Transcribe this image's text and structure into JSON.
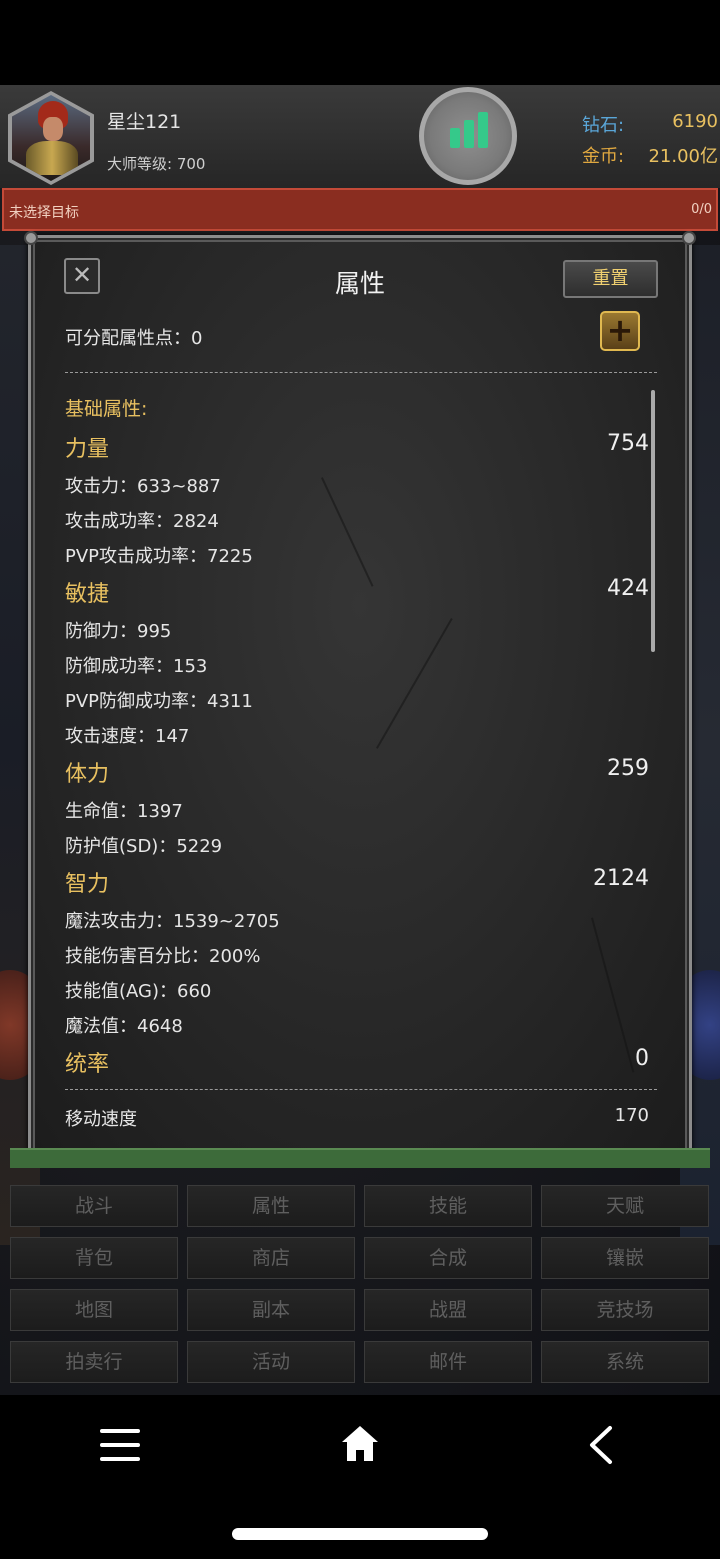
{
  "player": {
    "name": "星尘121",
    "master_level": "大师等级: 700"
  },
  "currency": {
    "diamond_label": "钻石:",
    "diamond_value": "6190",
    "gold_label": "金币:",
    "gold_value": "21.00亿"
  },
  "target": {
    "text": "未选择目标",
    "count": "0/0"
  },
  "panel": {
    "title": "属性",
    "reset_label": "重置",
    "plus_label": "+",
    "points_label": "可分配属性点：0",
    "basic_label": "基础属性:",
    "strength": {
      "label": "力量",
      "value": "754",
      "stats": [
        "攻击力：633~887",
        "攻击成功率：2824",
        "PVP攻击成功率：7225"
      ]
    },
    "agility": {
      "label": "敏捷",
      "value": "424",
      "stats": [
        "防御力：995",
        "防御成功率：153",
        "PVP防御成功率：4311",
        "攻击速度：147"
      ]
    },
    "vitality": {
      "label": "体力",
      "value": "259",
      "stats": [
        "生命值：1397",
        "防护值(SD)：5229"
      ]
    },
    "energy": {
      "label": "智力",
      "value": "2124",
      "stats": [
        "魔法攻击力：1539~2705",
        "技能伤害百分比：200%",
        "技能值(AG)：660",
        "魔法值：4648"
      ]
    },
    "command": {
      "label": "统率",
      "value": "0"
    },
    "move_speed": {
      "label": "移动速度",
      "value": "170"
    }
  },
  "menu": [
    [
      "战斗",
      "属性",
      "技能",
      "天赋"
    ],
    [
      "背包",
      "商店",
      "合成",
      "镶嵌"
    ],
    [
      "地图",
      "副本",
      "战盟",
      "竞技场"
    ],
    [
      "拍卖行",
      "活动",
      "邮件",
      "系统"
    ]
  ],
  "icons": {
    "close": "close-icon",
    "plus": "plus-icon",
    "stats": "bar-chart-icon",
    "nav_menu": "menu-icon",
    "nav_home": "home-icon",
    "nav_back": "back-icon"
  },
  "colors": {
    "accent_gold": "#e8c060",
    "target_bar": "#8a2d20",
    "stats_green": "#35c98a"
  }
}
